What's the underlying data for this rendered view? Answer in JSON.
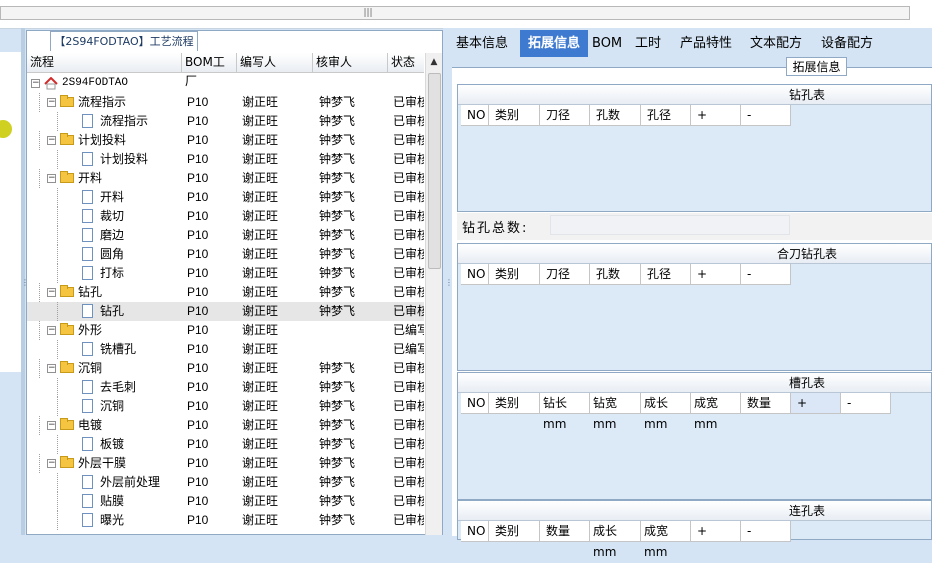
{
  "scrollbar": {
    "grip": "|||"
  },
  "tree": {
    "tab_label": "【2S94FODTAO】工艺流程",
    "columns": [
      "流程",
      "BOM工厂",
      "编写人",
      "核审人",
      "状态"
    ],
    "rows": [
      {
        "name": "2S94FODTAO",
        "level": 0,
        "kind": "root",
        "factory": "",
        "writer": "",
        "reviewer": "",
        "status": ""
      },
      {
        "name": "流程指示",
        "level": 1,
        "kind": "folder",
        "factory": "P10",
        "writer": "谢正旺",
        "reviewer": "钟梦飞",
        "status": "已审核"
      },
      {
        "name": "流程指示",
        "level": 2,
        "kind": "page",
        "factory": "P10",
        "writer": "谢正旺",
        "reviewer": "钟梦飞",
        "status": "已审核"
      },
      {
        "name": "计划投料",
        "level": 1,
        "kind": "folder",
        "factory": "P10",
        "writer": "谢正旺",
        "reviewer": "钟梦飞",
        "status": "已审核"
      },
      {
        "name": "计划投料",
        "level": 2,
        "kind": "page",
        "factory": "P10",
        "writer": "谢正旺",
        "reviewer": "钟梦飞",
        "status": "已审核"
      },
      {
        "name": "开料",
        "level": 1,
        "kind": "folder",
        "factory": "P10",
        "writer": "谢正旺",
        "reviewer": "钟梦飞",
        "status": "已审核"
      },
      {
        "name": "开料",
        "level": 2,
        "kind": "page",
        "factory": "P10",
        "writer": "谢正旺",
        "reviewer": "钟梦飞",
        "status": "已审核"
      },
      {
        "name": "裁切",
        "level": 2,
        "kind": "page",
        "factory": "P10",
        "writer": "谢正旺",
        "reviewer": "钟梦飞",
        "status": "已审核"
      },
      {
        "name": "磨边",
        "level": 2,
        "kind": "page",
        "factory": "P10",
        "writer": "谢正旺",
        "reviewer": "钟梦飞",
        "status": "已审核"
      },
      {
        "name": "圆角",
        "level": 2,
        "kind": "page",
        "factory": "P10",
        "writer": "谢正旺",
        "reviewer": "钟梦飞",
        "status": "已审核"
      },
      {
        "name": "打标",
        "level": 2,
        "kind": "page",
        "factory": "P10",
        "writer": "谢正旺",
        "reviewer": "钟梦飞",
        "status": "已审核"
      },
      {
        "name": "钻孔",
        "level": 1,
        "kind": "folder",
        "factory": "P10",
        "writer": "谢正旺",
        "reviewer": "钟梦飞",
        "status": "已审核"
      },
      {
        "name": "钻孔",
        "level": 2,
        "kind": "page",
        "factory": "P10",
        "writer": "谢正旺",
        "reviewer": "钟梦飞",
        "status": "已审核",
        "selected": true
      },
      {
        "name": "外形",
        "level": 1,
        "kind": "folder",
        "factory": "P10",
        "writer": "谢正旺",
        "reviewer": "",
        "status": "已编写"
      },
      {
        "name": "铣槽孔",
        "level": 2,
        "kind": "page",
        "factory": "P10",
        "writer": "谢正旺",
        "reviewer": "",
        "status": "已编写"
      },
      {
        "name": "沉铜",
        "level": 1,
        "kind": "folder",
        "factory": "P10",
        "writer": "谢正旺",
        "reviewer": "钟梦飞",
        "status": "已审核"
      },
      {
        "name": "去毛刺",
        "level": 2,
        "kind": "page",
        "factory": "P10",
        "writer": "谢正旺",
        "reviewer": "钟梦飞",
        "status": "已审核"
      },
      {
        "name": "沉铜",
        "level": 2,
        "kind": "page",
        "factory": "P10",
        "writer": "谢正旺",
        "reviewer": "钟梦飞",
        "status": "已审核"
      },
      {
        "name": "电镀",
        "level": 1,
        "kind": "folder",
        "factory": "P10",
        "writer": "谢正旺",
        "reviewer": "钟梦飞",
        "status": "已审核"
      },
      {
        "name": "板镀",
        "level": 2,
        "kind": "page",
        "factory": "P10",
        "writer": "谢正旺",
        "reviewer": "钟梦飞",
        "status": "已审核"
      },
      {
        "name": "外层干膜",
        "level": 1,
        "kind": "folder",
        "factory": "P10",
        "writer": "谢正旺",
        "reviewer": "钟梦飞",
        "status": "已审核"
      },
      {
        "name": "外层前处理",
        "level": 2,
        "kind": "page",
        "factory": "P10",
        "writer": "谢正旺",
        "reviewer": "钟梦飞",
        "status": "已审核"
      },
      {
        "name": "贴膜",
        "level": 2,
        "kind": "page",
        "factory": "P10",
        "writer": "谢正旺",
        "reviewer": "钟梦飞",
        "status": "已审核"
      },
      {
        "name": "曝光",
        "level": 2,
        "kind": "page",
        "factory": "P10",
        "writer": "谢正旺",
        "reviewer": "钟梦飞",
        "status": "已审核"
      }
    ]
  },
  "right": {
    "tabs": [
      "基本信息",
      "拓展信息",
      "BOM",
      "工时",
      "产品特性",
      "文本配方",
      "设备配方"
    ],
    "active_tab": "拓展信息",
    "subtab": "拓展信息",
    "drill_table": {
      "title": "钻孔表",
      "columns": [
        "NO",
        "类别",
        "刀径",
        "孔数",
        "孔径",
        "+",
        "-"
      ]
    },
    "drill_total_label": "钻孔总数:",
    "drill_total_value": "",
    "combo_table": {
      "title": "合刀钻孔表",
      "columns": [
        "NO",
        "类别",
        "刀径",
        "孔数",
        "孔径",
        "+",
        "-"
      ]
    },
    "slot_table": {
      "title": "槽孔表",
      "columns": [
        "NO",
        "类别",
        "钻长mm",
        "钻宽mm",
        "成长mm",
        "成宽mm",
        "数量",
        "+",
        "-"
      ]
    },
    "link_table": {
      "title": "连孔表",
      "columns": [
        "NO",
        "类别",
        "数量",
        "成长mm",
        "成宽mm",
        "+",
        "-"
      ]
    }
  }
}
